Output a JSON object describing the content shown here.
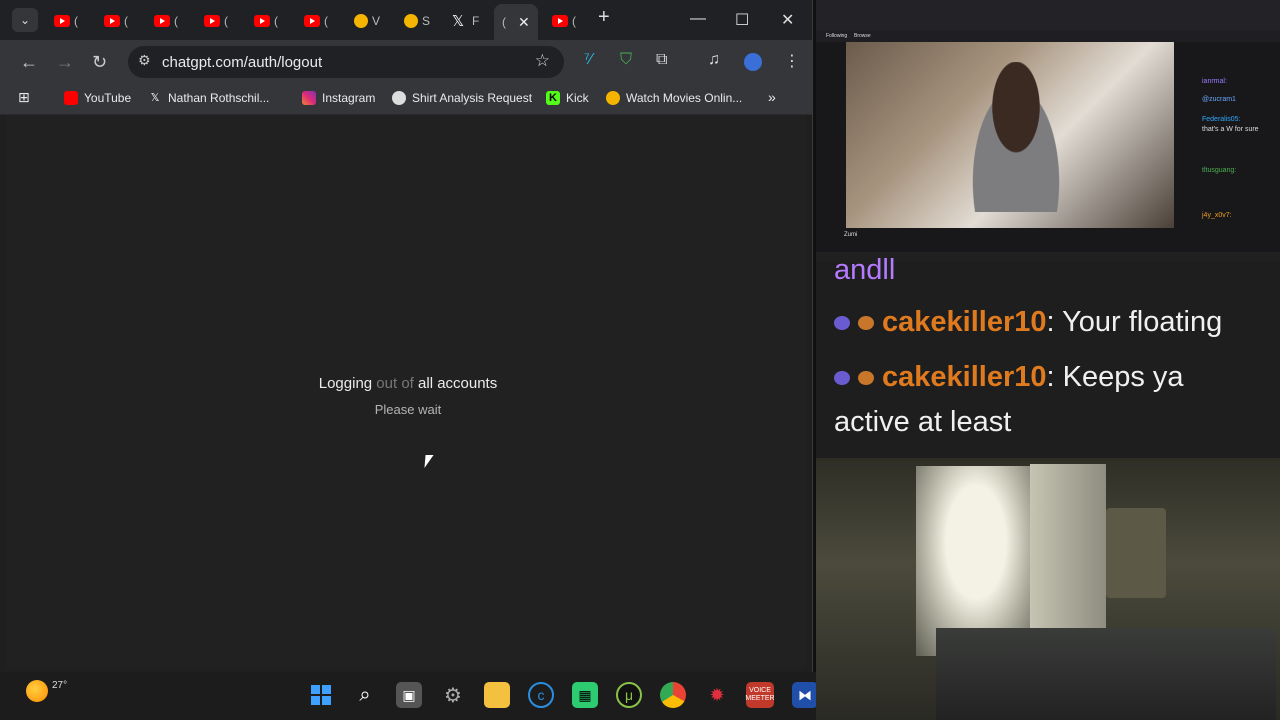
{
  "browser": {
    "tabs": [
      {
        "label": "(",
        "icon": "youtube-icon"
      },
      {
        "label": "(",
        "icon": "youtube-icon"
      },
      {
        "label": "(",
        "icon": "youtube-icon"
      },
      {
        "label": "(",
        "icon": "youtube-icon"
      },
      {
        "label": "(",
        "icon": "youtube-icon"
      },
      {
        "label": "(",
        "icon": "youtube-icon"
      },
      {
        "label": "V",
        "icon": "movies-icon"
      },
      {
        "label": "S",
        "icon": "movies-icon"
      },
      {
        "label": "F",
        "icon": "x-icon"
      },
      {
        "label": "(",
        "icon": "chatgpt-icon",
        "active": true
      },
      {
        "label": "(",
        "icon": "youtube-icon"
      }
    ],
    "url": "chatgpt.com/auth/logout",
    "bookmarks": [
      {
        "label": "YouTube",
        "icon": "youtube-icon"
      },
      {
        "label": "Nathan Rothschil...",
        "icon": "x-icon"
      },
      {
        "label": "Instagram",
        "icon": "instagram-icon"
      },
      {
        "label": "Shirt Analysis Request",
        "icon": "chatgpt-icon"
      },
      {
        "label": "Kick",
        "icon": "kick-icon"
      },
      {
        "label": "Watch Movies Onlin...",
        "icon": "movies-icon"
      }
    ],
    "bookmarks_more": "»"
  },
  "page": {
    "title_part1": "Logging",
    "title_part2": " out of ",
    "title_part3": "all accounts",
    "subtitle": "Please wait"
  },
  "taskbar": {
    "weather_temp": "27°"
  },
  "stream": {
    "nav_following": "Following",
    "nav_browse": "Browse",
    "streamer_name": "Zumi",
    "mini_chat": [
      {
        "user": "ianrmal:",
        "text": ""
      },
      {
        "user": "",
        "text": "@zucram1"
      },
      {
        "user": "Federalis05:",
        "text": "that's a W for sure"
      },
      {
        "user": "tltusguang:",
        "text": ""
      },
      {
        "user": "j4y_x0v7:",
        "text": ""
      }
    ]
  },
  "chat": {
    "partial_line": "andll",
    "lines": [
      {
        "user": "cakekiller10",
        "text": ": Your floating"
      },
      {
        "user": "cakekiller10",
        "text": ": Keeps ya"
      }
    ],
    "continuation": "active at least"
  },
  "colors": {
    "page_bg": "#212121",
    "chat_user": "#e07a1f"
  }
}
